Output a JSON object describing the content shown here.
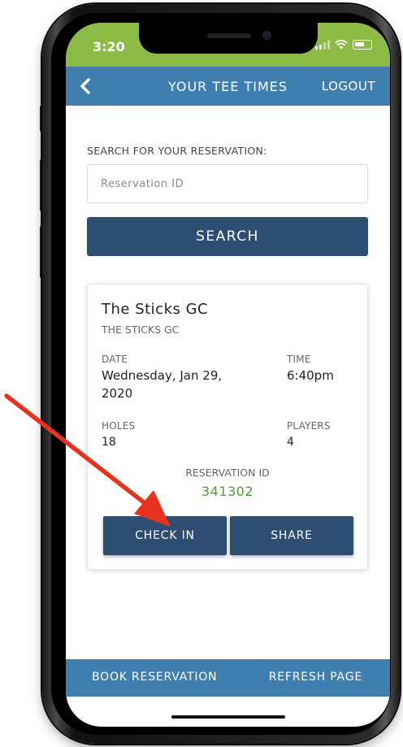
{
  "status_bar": {
    "time": "3:20",
    "background_color": "#8bba45"
  },
  "header": {
    "back_icon": "chevron-left-icon",
    "title": "YOUR TEE TIMES",
    "logout_label": "LOGOUT",
    "background_color": "#3f7fb0"
  },
  "search": {
    "label": "SEARCH FOR YOUR RESERVATION:",
    "placeholder": "Reservation ID",
    "value": "",
    "button_label": "SEARCH",
    "button_color": "#2d4e72"
  },
  "reservation": {
    "course_name": "The Sticks GC",
    "course_subtitle": "THE STICKS GC",
    "date_label": "DATE",
    "date_line1": "Wednesday, Jan 29,",
    "date_line2": "2020",
    "time_label": "TIME",
    "time_value": "6:40pm",
    "holes_label": "HOLES",
    "holes_value": "18",
    "players_label": "PLAYERS",
    "players_value": "4",
    "reservation_id_label": "RESERVATION ID",
    "reservation_id": "341302",
    "reservation_id_color": "#4f9a3e",
    "check_in_label": "CHECK IN",
    "share_label": "SHARE"
  },
  "bottom_bar": {
    "book_label": "BOOK RESERVATION",
    "refresh_label": "REFRESH PAGE"
  },
  "annotation": {
    "arrow_color": "#e8321e",
    "points_to": "check-in-button"
  }
}
